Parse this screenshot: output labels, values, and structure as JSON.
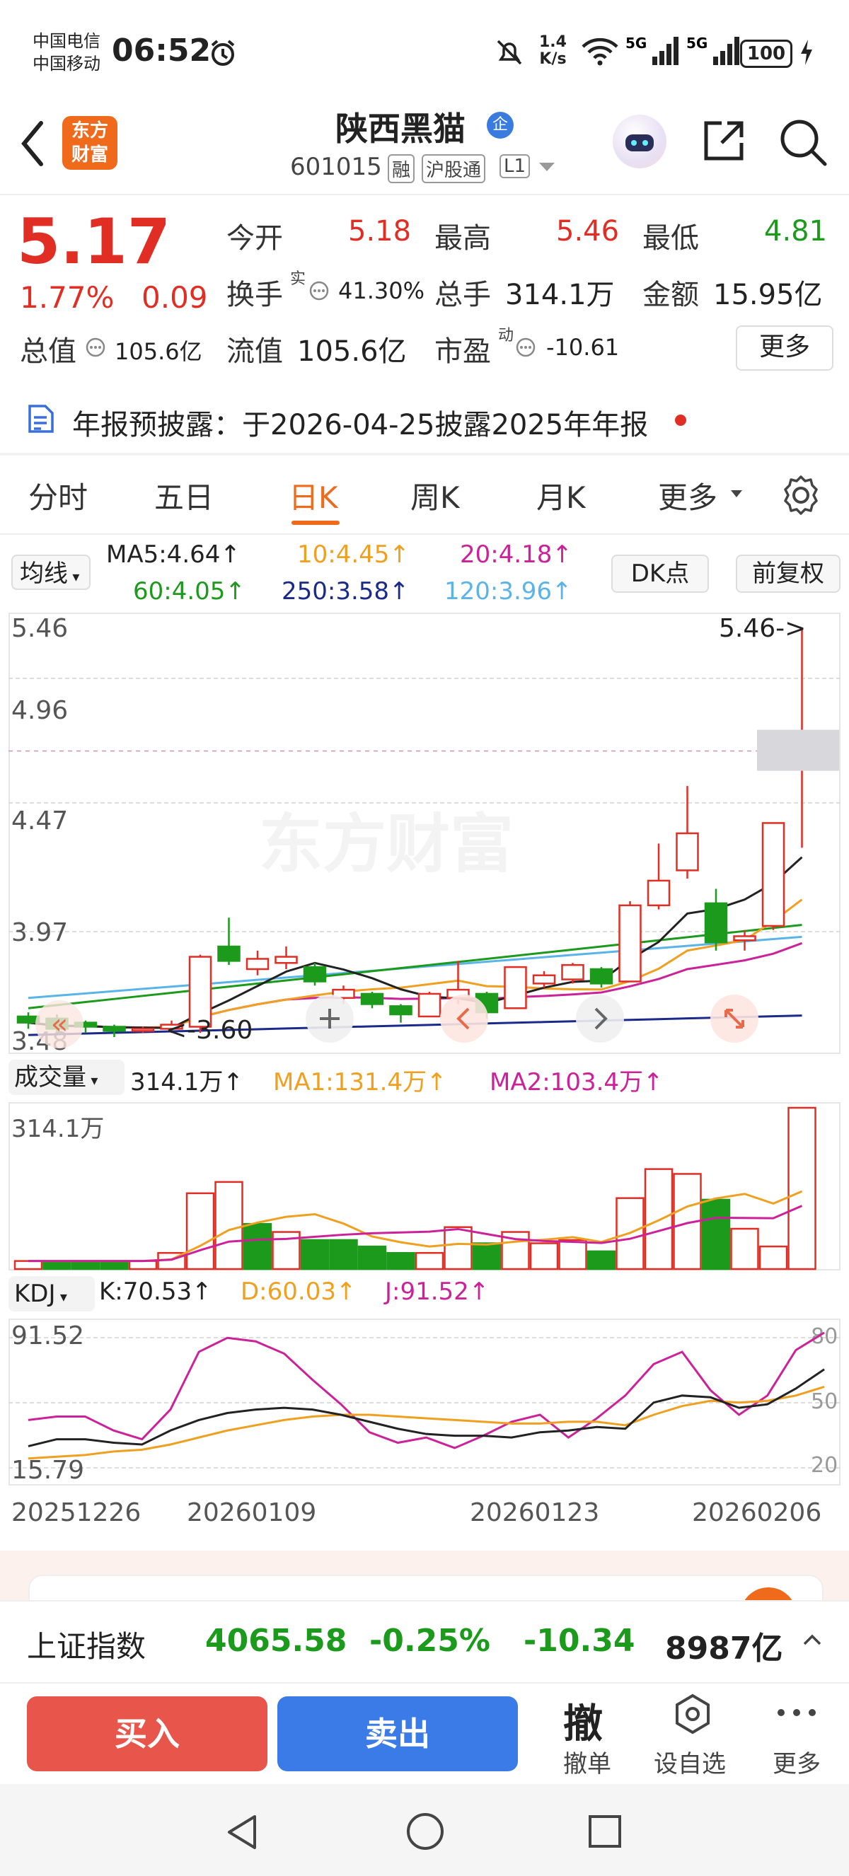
{
  "status_bar": {
    "carrier1": "中国电信",
    "carrier2": "中国移动",
    "time": "06:52",
    "net_speed_top": "1.4",
    "net_speed_bottom": "K/s",
    "battery": "100"
  },
  "header": {
    "logo_line1": "东方",
    "logo_line2": "财富",
    "stock_name": "陕西黑猫",
    "badge": "企",
    "code": "601015",
    "tags": [
      "融",
      "沪股通",
      "L1"
    ]
  },
  "quote": {
    "price": "5.17",
    "change_pct": "1.77%",
    "change_amt": "0.09",
    "open_label": "今开",
    "open": "5.18",
    "high_label": "最高",
    "high": "5.46",
    "low_label": "最低",
    "low": "4.81",
    "turnover_label": "换手",
    "turnover_sup": "实",
    "turnover": "41.30%",
    "volume_label": "总手",
    "volume": "314.1万",
    "amount_label": "金额",
    "amount": "15.95亿",
    "total_value_label": "总值",
    "total_value": "105.6亿",
    "float_value_label": "流值",
    "float_value": "105.6亿",
    "pe_label": "市盈",
    "pe_sup": "动",
    "pe": "-10.61",
    "more_button": "更多"
  },
  "notice": {
    "text": "年报预披露：于2026-04-25披露2025年年报"
  },
  "tabs": [
    {
      "label": "分时"
    },
    {
      "label": "五日"
    },
    {
      "label": "日K",
      "active": true
    },
    {
      "label": "周K"
    },
    {
      "label": "月K"
    },
    {
      "label": "更多"
    }
  ],
  "ma_legend": {
    "selector": "均线",
    "ma5": "MA5:4.64↑",
    "ma10": "10:4.45↑",
    "ma20": "20:4.18↑",
    "ma60": "60:4.05↑",
    "ma250": "250:3.58↑",
    "ma120": "120:3.96↑",
    "dk_button": "DK点",
    "adjust_button": "前复权"
  },
  "colors": {
    "up": "#e02e24",
    "down": "#1c9a1c",
    "ma5": "#222222",
    "ma10": "#f0a020",
    "ma20": "#cc2299",
    "ma60": "#1c9a1c",
    "ma250": "#1a2a8a",
    "ma120": "#5ab4e8"
  },
  "price_chart": {
    "y_ticks": [
      "5.46",
      "4.96",
      "4.47",
      "3.97",
      "3.48"
    ],
    "high_marker": "5.46->",
    "low_marker": "<-3.60"
  },
  "volume_legend": {
    "selector": "成交量",
    "value": "314.1万↑",
    "ma1": "MA1:131.4万↑",
    "ma2": "MA2:103.4万↑",
    "max_label": "314.1万"
  },
  "kdj_legend": {
    "selector": "KDJ",
    "k": "K:70.53↑",
    "d": "D:60.03↑",
    "j": "J:91.52↑",
    "max_label": "91.52",
    "min_label": "15.79",
    "right_ticks": [
      "80",
      "50",
      "20"
    ]
  },
  "x_dates": [
    "20251226",
    "20260109",
    "20260123",
    "20260206"
  ],
  "chart_data": {
    "type": "candlestick",
    "ylim": [
      3.48,
      5.46
    ],
    "candles": [
      {
        "o": 3.58,
        "c": 3.55,
        "h": 3.6,
        "l": 3.52
      },
      {
        "o": 3.57,
        "c": 3.52,
        "h": 3.59,
        "l": 3.5
      },
      {
        "o": 3.55,
        "c": 3.53,
        "h": 3.56,
        "l": 3.5
      },
      {
        "o": 3.53,
        "c": 3.51,
        "h": 3.54,
        "l": 3.48
      },
      {
        "o": 3.52,
        "c": 3.52,
        "h": 3.53,
        "l": 3.5
      },
      {
        "o": 3.52,
        "c": 3.54,
        "h": 3.56,
        "l": 3.5
      },
      {
        "o": 3.53,
        "c": 3.87,
        "h": 3.88,
        "l": 3.5
      },
      {
        "o": 3.92,
        "c": 3.85,
        "h": 4.06,
        "l": 3.83
      },
      {
        "o": 3.81,
        "c": 3.86,
        "h": 3.9,
        "l": 3.78
      },
      {
        "o": 3.84,
        "c": 3.87,
        "h": 3.92,
        "l": 3.81
      },
      {
        "o": 3.82,
        "c": 3.75,
        "h": 3.84,
        "l": 3.73
      },
      {
        "o": 3.67,
        "c": 3.71,
        "h": 3.73,
        "l": 3.64
      },
      {
        "o": 3.69,
        "c": 3.64,
        "h": 3.7,
        "l": 3.62
      },
      {
        "o": 3.63,
        "c": 3.59,
        "h": 3.64,
        "l": 3.55
      },
      {
        "o": 3.58,
        "c": 3.69,
        "h": 3.7,
        "l": 3.58
      },
      {
        "o": 3.67,
        "c": 3.71,
        "h": 3.85,
        "l": 3.64
      },
      {
        "o": 3.69,
        "c": 3.6,
        "h": 3.7,
        "l": 3.57
      },
      {
        "o": 3.62,
        "c": 3.82,
        "h": 3.82,
        "l": 3.62
      },
      {
        "o": 3.74,
        "c": 3.78,
        "h": 3.8,
        "l": 3.72
      },
      {
        "o": 3.76,
        "c": 3.83,
        "h": 3.84,
        "l": 3.74
      },
      {
        "o": 3.81,
        "c": 3.74,
        "h": 3.82,
        "l": 3.72
      },
      {
        "o": 3.75,
        "c": 4.12,
        "h": 4.14,
        "l": 3.75
      },
      {
        "o": 4.12,
        "c": 4.24,
        "h": 4.42,
        "l": 4.1
      },
      {
        "o": 4.29,
        "c": 4.47,
        "h": 4.7,
        "l": 4.25
      },
      {
        "o": 4.13,
        "c": 3.94,
        "h": 4.2,
        "l": 3.9
      },
      {
        "o": 3.95,
        "c": 3.97,
        "h": 4.0,
        "l": 3.9
      },
      {
        "o": 4.02,
        "c": 4.52,
        "h": 4.52,
        "l": 4.0
      },
      {
        "o": 4.86,
        "c": 4.87,
        "h": 5.46,
        "l": 4.4
      }
    ],
    "volume": [
      {
        "v": 5,
        "up": true
      },
      {
        "v": 5,
        "up": false
      },
      {
        "v": 5,
        "up": false
      },
      {
        "v": 5,
        "up": false
      },
      {
        "v": 5,
        "up": true
      },
      {
        "v": 10,
        "up": true
      },
      {
        "v": 47,
        "up": true
      },
      {
        "v": 54,
        "up": true
      },
      {
        "v": 28,
        "up": false
      },
      {
        "v": 23,
        "up": true
      },
      {
        "v": 18,
        "up": false
      },
      {
        "v": 18,
        "up": false
      },
      {
        "v": 14,
        "up": false
      },
      {
        "v": 10,
        "up": false
      },
      {
        "v": 10,
        "up": true
      },
      {
        "v": 26,
        "up": true
      },
      {
        "v": 16,
        "up": false
      },
      {
        "v": 23,
        "up": true
      },
      {
        "v": 16,
        "up": true
      },
      {
        "v": 18,
        "up": true
      },
      {
        "v": 11,
        "up": false
      },
      {
        "v": 44,
        "up": true
      },
      {
        "v": 62,
        "up": true
      },
      {
        "v": 59,
        "up": true
      },
      {
        "v": 43,
        "up": false
      },
      {
        "v": 25,
        "up": true
      },
      {
        "v": 14,
        "up": true
      },
      {
        "v": 100,
        "up": true
      }
    ],
    "kdj": {
      "k": [
        26,
        30,
        30,
        28,
        27,
        35,
        41,
        45,
        47,
        48,
        47,
        44,
        40,
        36,
        33,
        32,
        32,
        31,
        34,
        35,
        37,
        36,
        51,
        55,
        54,
        48,
        50,
        59,
        70
      ],
      "d": [
        19,
        20,
        21,
        23,
        24,
        27,
        31,
        35,
        38,
        41,
        43,
        44,
        44,
        43,
        42,
        41,
        40,
        39,
        39,
        40,
        40,
        38,
        44,
        49,
        52,
        51,
        52,
        55,
        60
      ],
      "j": [
        41,
        43,
        43,
        35,
        30,
        47,
        80,
        88,
        86,
        79,
        64,
        50,
        34,
        28,
        31,
        25,
        32,
        40,
        44,
        31,
        42,
        55,
        73,
        80,
        58,
        44,
        55,
        81,
        91
      ]
    }
  },
  "market_bar": {
    "index_name": "上证指数",
    "index_value": "4065.58",
    "change_pct": "-0.25%",
    "change_amt": "-10.34",
    "turnover": "8987亿"
  },
  "bottom_bar": {
    "buy": "买入",
    "sell": "卖出",
    "cancel_icon": "撤",
    "cancel_label": "撤单",
    "watch_label": "设自选",
    "more_label": "更多"
  }
}
